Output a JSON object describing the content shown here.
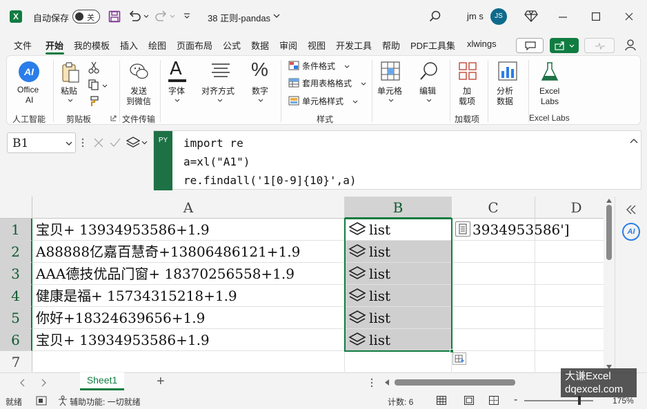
{
  "titlebar": {
    "autosave_label": "自动保存",
    "autosave_state": "关",
    "doc_title": "38 正则-pandas",
    "user_name": "jm s",
    "user_initials": "JS"
  },
  "menu": {
    "tabs": [
      "文件",
      "开始",
      "我的模板",
      "插入",
      "绘图",
      "页面布局",
      "公式",
      "数据",
      "审阅",
      "视图",
      "开发工具",
      "帮助",
      "PDF工具集",
      "xlwings"
    ],
    "active": "开始"
  },
  "ribbon": {
    "office_ai": "Office AI",
    "office_ai_line1": "Office",
    "office_ai_line2": "AI",
    "group_ai": "人工智能",
    "paste": "粘贴",
    "group_clipboard": "剪贴板",
    "send_wechat_1": "发送",
    "send_wechat_2": "到微信",
    "group_transfer": "文件传输",
    "font": "字体",
    "alignment": "对齐方式",
    "number": "数字",
    "cond_format": "条件格式",
    "table_format": "套用表格格式",
    "cell_style": "单元格样式",
    "group_style": "样式",
    "cells": "单元格",
    "edit": "编辑",
    "addin_1": "加",
    "addin_2": "载项",
    "group_addin": "加载项",
    "analyze_1": "分析",
    "analyze_2": "数据",
    "excel_labs_1": "Excel",
    "excel_labs_2": "Labs",
    "group_labs": "Excel Labs",
    "ai_glyph": "AI",
    "number_glyph": "%",
    "font_glyph": "A"
  },
  "formula_bar": {
    "name_box": "B1",
    "badge": "PY",
    "code": [
      "import re",
      "a=xl(\"A1\")",
      "re.findall('1[0-9]{10}',a)"
    ]
  },
  "grid": {
    "columns": [
      "A",
      "B",
      "C",
      "D"
    ],
    "rows": [
      "1",
      "2",
      "3",
      "4",
      "5",
      "6",
      "7"
    ],
    "col_a": [
      "宝贝+ 13934953586+1.9",
      "A88888亿嘉百慧奇+13806486121+1.9",
      "AAA德技优品门窗+ 18370256558+1.9",
      "健康是福+ 15734315218+1.9",
      "你好+18324639656+1.9",
      "宝贝+ 13934953586+1.9"
    ],
    "col_b": [
      "list",
      "list",
      "list",
      "list",
      "list",
      "list"
    ],
    "c1_text": "['13934953586']"
  },
  "sheets": {
    "tabs": [
      "Sheet1"
    ],
    "active": "Sheet1",
    "add": "+"
  },
  "status": {
    "ready": "就绪",
    "accessibility": "辅助功能: 一切就绪",
    "count": "计数: 6",
    "zoom": "175%"
  },
  "watermark": {
    "line1": "大谦Excel",
    "line2": "dqexcel.com"
  },
  "colors": {
    "excel_green": "#107c41",
    "py_green": "#1e7145",
    "selection_fill": "#cfcfcf"
  }
}
